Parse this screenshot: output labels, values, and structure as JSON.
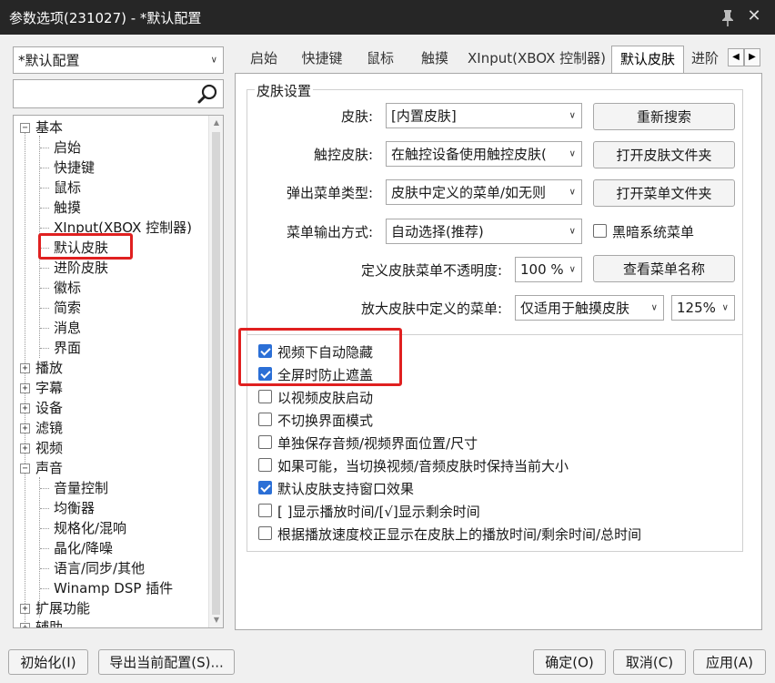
{
  "window": {
    "title": "参数选项(231027) - *默认配置"
  },
  "profile_select": {
    "value": "*默认配置"
  },
  "search": {
    "value": ""
  },
  "tree": {
    "basic": "基本",
    "basic_children": [
      "启始",
      "快捷键",
      "鼠标",
      "触摸",
      "XInput(XBOX 控制器)",
      "默认皮肤",
      "进阶皮肤",
      "徽标",
      "简索",
      "消息",
      "界面"
    ],
    "playback": "播放",
    "subtitle": "字幕",
    "device": "设备",
    "filter": "滤镜",
    "video": "视频",
    "audio": "声音",
    "audio_children": [
      "音量控制",
      "均衡器",
      "规格化/混响",
      "晶化/降噪",
      "语言/同步/其他",
      "Winamp DSP 插件"
    ],
    "extensions": "扩展功能",
    "assist": "辅助"
  },
  "tabs": [
    "启始",
    "快捷键",
    "鼠标",
    "触摸",
    "XInput(XBOX 控制器)",
    "默认皮肤",
    "进阶"
  ],
  "group": {
    "title": "皮肤设置",
    "skin": {
      "label": "皮肤:",
      "value": "[内置皮肤]"
    },
    "touch_skin": {
      "label": "触控皮肤:",
      "value": "在触控设备使用触控皮肤("
    },
    "popup_type": {
      "label": "弹出菜单类型:",
      "value": "皮肤中定义的菜单/如无则"
    },
    "menu_output": {
      "label": "菜单输出方式:",
      "value": "自动选择(推荐)"
    },
    "opacity": {
      "label": "定义皮肤菜单不透明度:",
      "value": "100 %"
    },
    "zoom_menu": {
      "label": "放大皮肤中定义的菜单:",
      "value": "仅适用于触摸皮肤",
      "scale": "125%"
    },
    "btn_rescan": "重新搜索",
    "btn_open_skin_folder": "打开皮肤文件夹",
    "btn_open_menu_folder": "打开菜单文件夹",
    "btn_view_menu_names": "查看菜单名称",
    "dark_menu": {
      "label": "黑暗系统菜单",
      "checked": false
    }
  },
  "options": [
    {
      "label": "视频下自动隐藏",
      "checked": true
    },
    {
      "label": "全屏时防止遮盖",
      "checked": true
    },
    {
      "label": "以视频皮肤启动",
      "checked": false
    },
    {
      "label": "不切换界面模式",
      "checked": false
    },
    {
      "label": "单独保存音频/视频界面位置/尺寸",
      "checked": false
    },
    {
      "label": "如果可能，当切换视频/音频皮肤时保持当前大小",
      "checked": false
    },
    {
      "label": "默认皮肤支持窗口效果",
      "checked": true
    },
    {
      "label": "[ ]显示播放时间/[√]显示剩余时间",
      "checked": false
    },
    {
      "label": "根据播放速度校正显示在皮肤上的播放时间/剩余时间/总时间",
      "checked": false
    }
  ],
  "footer": {
    "init": "初始化(I)",
    "export": "导出当前配置(S)...",
    "ok": "确定(O)",
    "cancel": "取消(C)",
    "apply": "应用(A)"
  },
  "colors": {
    "highlight_border": "#e02020",
    "check_blue": "#2b6fd6",
    "titlebar": "#262626"
  }
}
